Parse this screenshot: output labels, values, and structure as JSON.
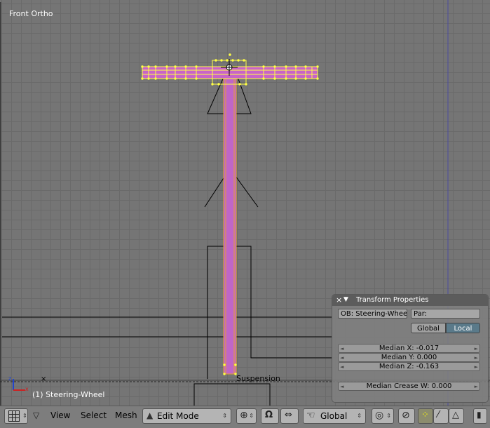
{
  "viewport": {
    "view_name": "Front Ortho",
    "object_label": "(1) Steering-Wheel",
    "suspension_label": "Suspension",
    "axis_z_label": "z",
    "axis_x_label": "x"
  },
  "transform_panel": {
    "title": "Transform Properties",
    "close_icon": "close-icon",
    "collapse_icon": "triangle-down-icon",
    "object_field": "OB: Steering-Wheel",
    "parent_field": "Par:",
    "global_label": "Global",
    "local_label": "Local",
    "active_toggle": "Local",
    "median_x": "Median X: -0.017",
    "median_y": "Median Y: 0.000",
    "median_z": "Median Z: -0.163",
    "median_crease": "Median Crease W: 0.000"
  },
  "header": {
    "menus": [
      "View",
      "Select",
      "Mesh"
    ],
    "mode": "Edit Mode",
    "orientation": "Global",
    "icons": [
      "editor-type-grid-icon",
      "menu-collapse-icon",
      "mode-icon",
      "pivot-icon",
      "snap-magnet-icon",
      "manipulator-icon",
      "hand-icon",
      "proportional-edit-icon",
      "occlude-icon",
      "vertex-select-icon",
      "edge-select-icon",
      "face-select-icon",
      "lock-icon"
    ]
  },
  "colors": {
    "viewport_bg": "#757575",
    "grid": "#6a6a6a",
    "selection": "#ffff44",
    "mesh_face": "#c864c8",
    "panel_bg": "#808080",
    "header_bg": "#7d7d7d"
  }
}
